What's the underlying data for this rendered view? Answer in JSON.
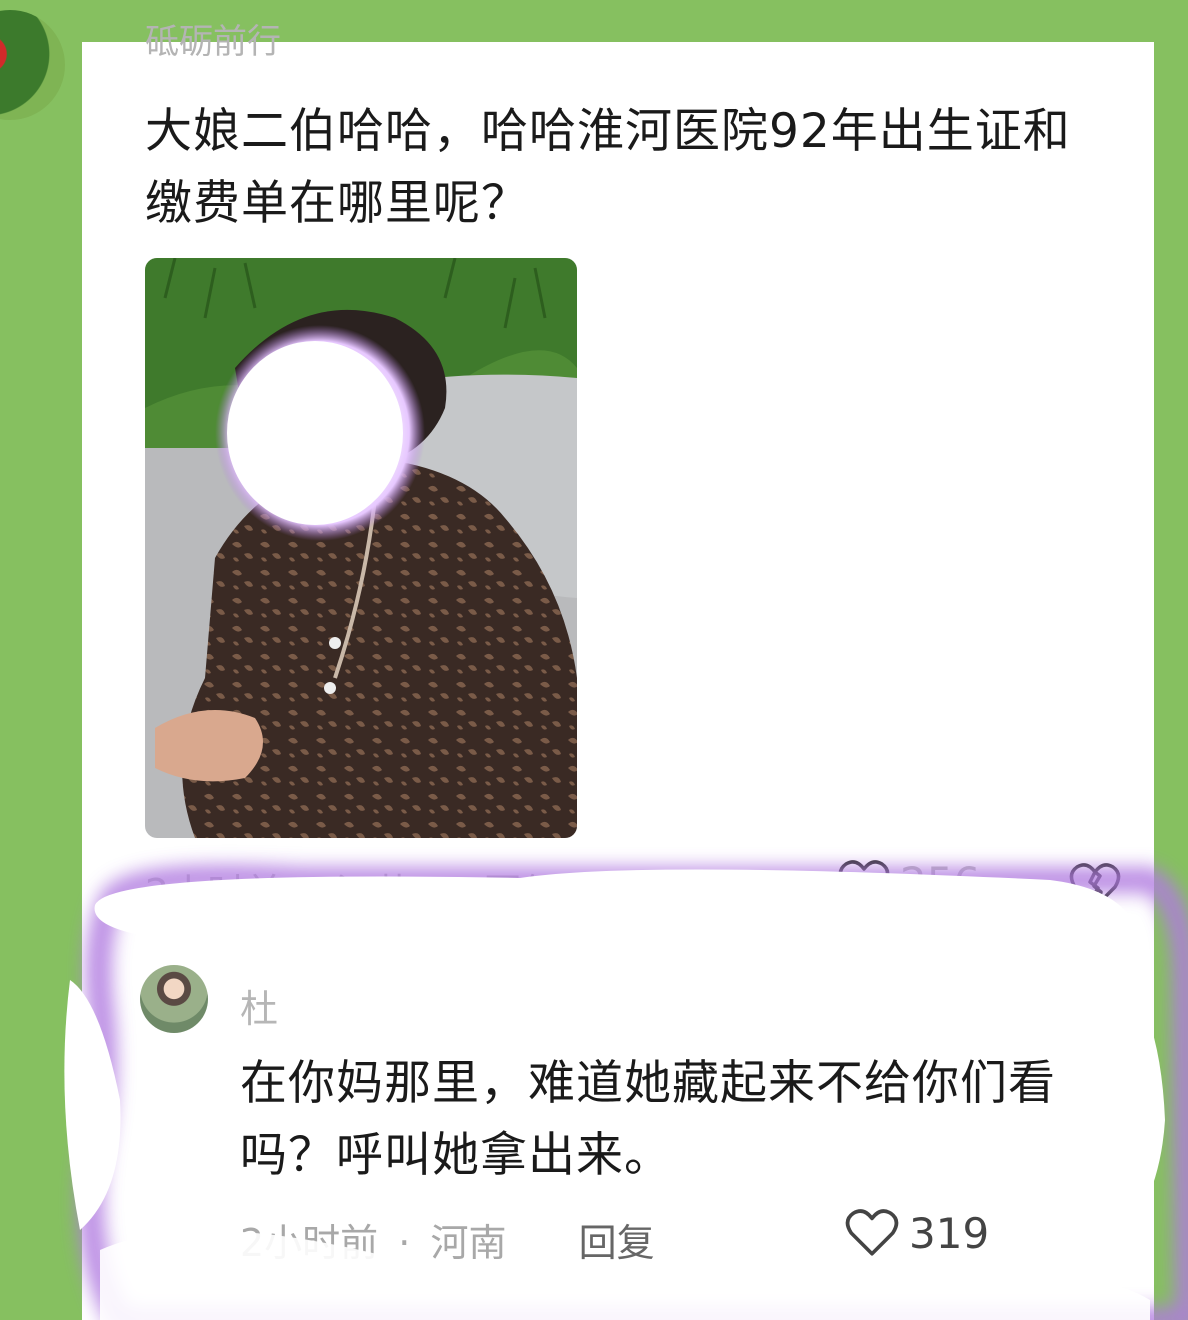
{
  "post": {
    "author_name": "砥砺前行",
    "comment_text": "大娘二伯哈哈，哈哈淮河医院92年出生证和缴费单在哪里呢？",
    "time": "2小时前",
    "location": "江苏",
    "reply_label": "回复",
    "likes": "256"
  },
  "reply": {
    "author_name_visible": "杜",
    "comment_text": "在你妈那里，难道她藏起来不给你们看\n吗？呼叫她拿出来。",
    "time": "2小时前",
    "location": "河南",
    "reply_label": "回复",
    "likes": "319"
  },
  "colors": {
    "frame_green": "#86c060",
    "highlight_purple": "#b07ae0",
    "text_dark": "#1a1a1a",
    "meta_gray": "#b9b9b9"
  },
  "icons": [
    "heart-outline-icon",
    "broken-heart-icon"
  ]
}
